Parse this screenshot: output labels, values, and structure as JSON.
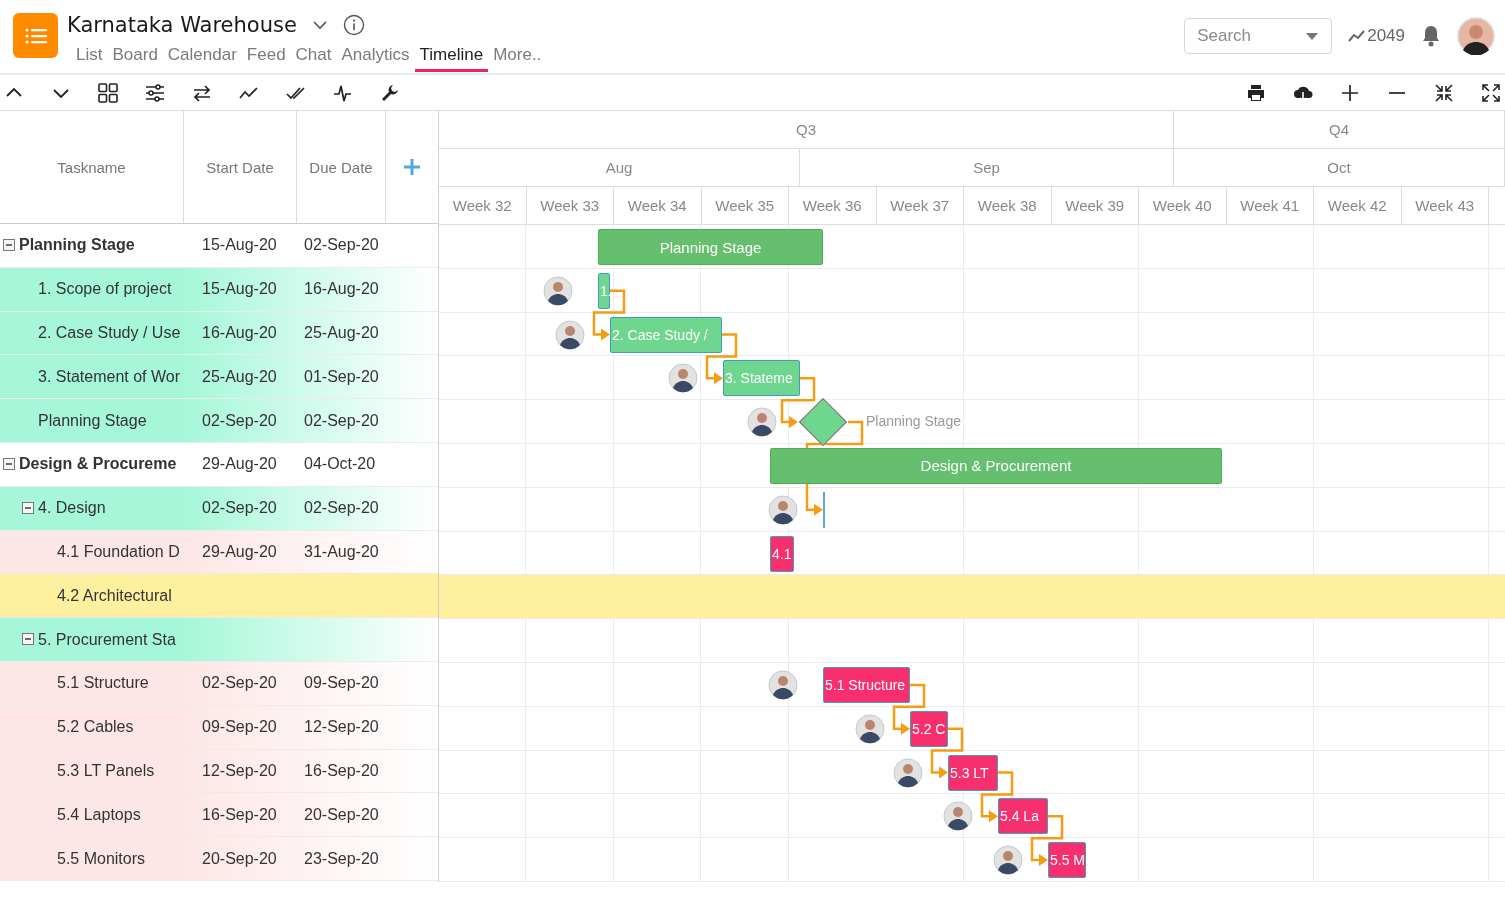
{
  "app": {
    "title": "Karnataka Warehouse"
  },
  "tabs": [
    {
      "label": "List",
      "selected": false
    },
    {
      "label": "Board",
      "selected": false
    },
    {
      "label": "Calendar",
      "selected": false
    },
    {
      "label": "Feed",
      "selected": false
    },
    {
      "label": "Chat",
      "selected": false
    },
    {
      "label": "Analytics",
      "selected": false
    },
    {
      "label": "Timeline",
      "selected": true
    },
    {
      "label": "More..",
      "selected": false
    }
  ],
  "search": {
    "placeholder": "Search"
  },
  "trend_count": "2049",
  "grid": {
    "columns": [
      "Taskname",
      "Start Date",
      "Due Date"
    ]
  },
  "timeline": {
    "quarters": [
      "Q3",
      "Q4"
    ],
    "months": [
      "Aug",
      "Sep",
      "Oct"
    ],
    "weeks": [
      "Week 32",
      "Week 33",
      "Week 34",
      "Week 35",
      "Week 36",
      "Week 37",
      "Week 38",
      "Week 39",
      "Week 40",
      "Week 41",
      "Week 42",
      "Week 43"
    ]
  },
  "tasks": [
    {
      "name": "Planning Stage",
      "start": "15-Aug-20",
      "due": "02-Sep-20",
      "expanded": true,
      "selected": false,
      "bar": {
        "kind": "summary",
        "label": "Planning Stage",
        "color": "#66bf6e"
      },
      "children": [
        {
          "name": "1. Scope of project",
          "start": "15-Aug-20",
          "due": "16-Aug-20",
          "color": "#a6f7da",
          "selected": false,
          "has_avatar": true,
          "bar": {
            "kind": "task",
            "label": "1.",
            "color": "#6fd690"
          }
        },
        {
          "name": "2. Case Study / Use",
          "start": "16-Aug-20",
          "due": "25-Aug-20",
          "color": "#a6f7da",
          "selected": false,
          "has_avatar": true,
          "has_predecessor": true,
          "bar": {
            "kind": "task",
            "label": "2. Case Study /",
            "color": "#6fd690"
          }
        },
        {
          "name": "3. Statement of Wor",
          "start": "25-Aug-20",
          "due": "01-Sep-20",
          "color": "#a6f7da",
          "selected": false,
          "has_avatar": true,
          "has_predecessor": true,
          "bar": {
            "kind": "task",
            "label": "3. Stateme",
            "color": "#6fd690"
          }
        },
        {
          "name": "Planning Stage",
          "start": "02-Sep-20",
          "due": "02-Sep-20",
          "color": "#a6f7da",
          "selected": false,
          "has_avatar": true,
          "has_predecessor": true,
          "bar": {
            "kind": "milestone",
            "label": "Planning Stage",
            "color": "#6fd690"
          }
        }
      ]
    },
    {
      "name": "Design & Procureme",
      "start": "29-Aug-20",
      "due": "04-Oct-20",
      "expanded": true,
      "selected": false,
      "bar": {
        "kind": "summary",
        "label": "Design & Procurement",
        "color": "#66bf6e"
      },
      "children": [
        {
          "name": "4. Design",
          "start": "02-Sep-20",
          "due": "02-Sep-20",
          "color": "#a6f7da",
          "expanded": true,
          "selected": false,
          "has_avatar": true,
          "has_predecessor": true,
          "bar": {
            "kind": "zero",
            "color": "#5aa6d6"
          },
          "children": [
            {
              "name": "4.1 Foundation D",
              "start": "29-Aug-20",
              "due": "31-Aug-20",
              "color": "#fde7e6",
              "selected": false,
              "bar": {
                "kind": "task",
                "label": "4.1",
                "color": "#f72f6e"
              }
            },
            {
              "name": "4.2 Architectural",
              "selected": true
            }
          ]
        },
        {
          "name": "5. Procurement Sta",
          "color": "#a6f7da",
          "expanded": true,
          "selected": false,
          "children": [
            {
              "name": "5.1 Structure",
              "start": "02-Sep-20",
              "due": "09-Sep-20",
              "color": "#fde7e6",
              "selected": false,
              "has_avatar": true,
              "bar": {
                "kind": "task",
                "label": "5.1 Structure",
                "color": "#f72f6e"
              }
            },
            {
              "name": "5.2 Cables",
              "start": "09-Sep-20",
              "due": "12-Sep-20",
              "color": "#fde7e6",
              "selected": false,
              "has_avatar": true,
              "has_predecessor": true,
              "bar": {
                "kind": "task",
                "label": "5.2 C",
                "color": "#f72f6e"
              }
            },
            {
              "name": "5.3 LT Panels",
              "start": "12-Sep-20",
              "due": "16-Sep-20",
              "color": "#fde7e6",
              "selected": false,
              "has_avatar": true,
              "has_predecessor": true,
              "bar": {
                "kind": "task",
                "label": "5.3 LT",
                "color": "#f72f6e"
              }
            },
            {
              "name": "5.4 Laptops",
              "start": "16-Sep-20",
              "due": "20-Sep-20",
              "color": "#fde7e6",
              "selected": false,
              "has_avatar": true,
              "has_predecessor": true,
              "bar": {
                "kind": "task",
                "label": "5.4 La",
                "color": "#f72f6e"
              }
            },
            {
              "name": "5.5 Monitors",
              "start": "20-Sep-20",
              "due": "23-Sep-20",
              "color": "#fde7e6",
              "selected": false,
              "has_avatar": true,
              "has_predecessor": true,
              "bar": {
                "kind": "task",
                "label": "5.5 M",
                "color": "#f72f6e"
              }
            }
          ]
        }
      ]
    }
  ]
}
